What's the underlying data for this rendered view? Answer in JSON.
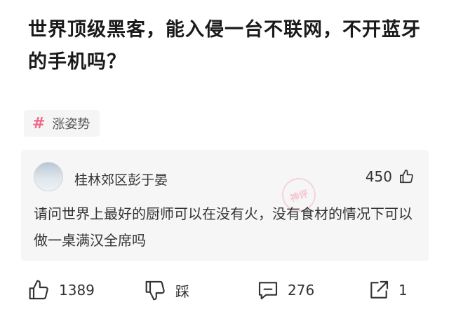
{
  "post": {
    "title": "世界顶级黑客，能入侵一台不联网，不开蓝牙的手机吗？"
  },
  "tag": {
    "symbol": "#",
    "label": "涨姿势"
  },
  "comment": {
    "username": "桂林郊区彭于晏",
    "likes": "450",
    "stamp": "神评",
    "text": "请问世界上最好的厨师可以在没有火，没有食材的情况下可以做一桌满汉全席吗"
  },
  "actions": {
    "like_count": "1389",
    "dislike_label": "踩",
    "comment_count": "276",
    "share_count": "1"
  },
  "colors": {
    "tag_accent": "#f06a8a",
    "card_bg": "#f6f6f6"
  },
  "icons": [
    "thumbs-up-icon",
    "thumbs-down-icon",
    "comment-icon",
    "share-icon"
  ]
}
